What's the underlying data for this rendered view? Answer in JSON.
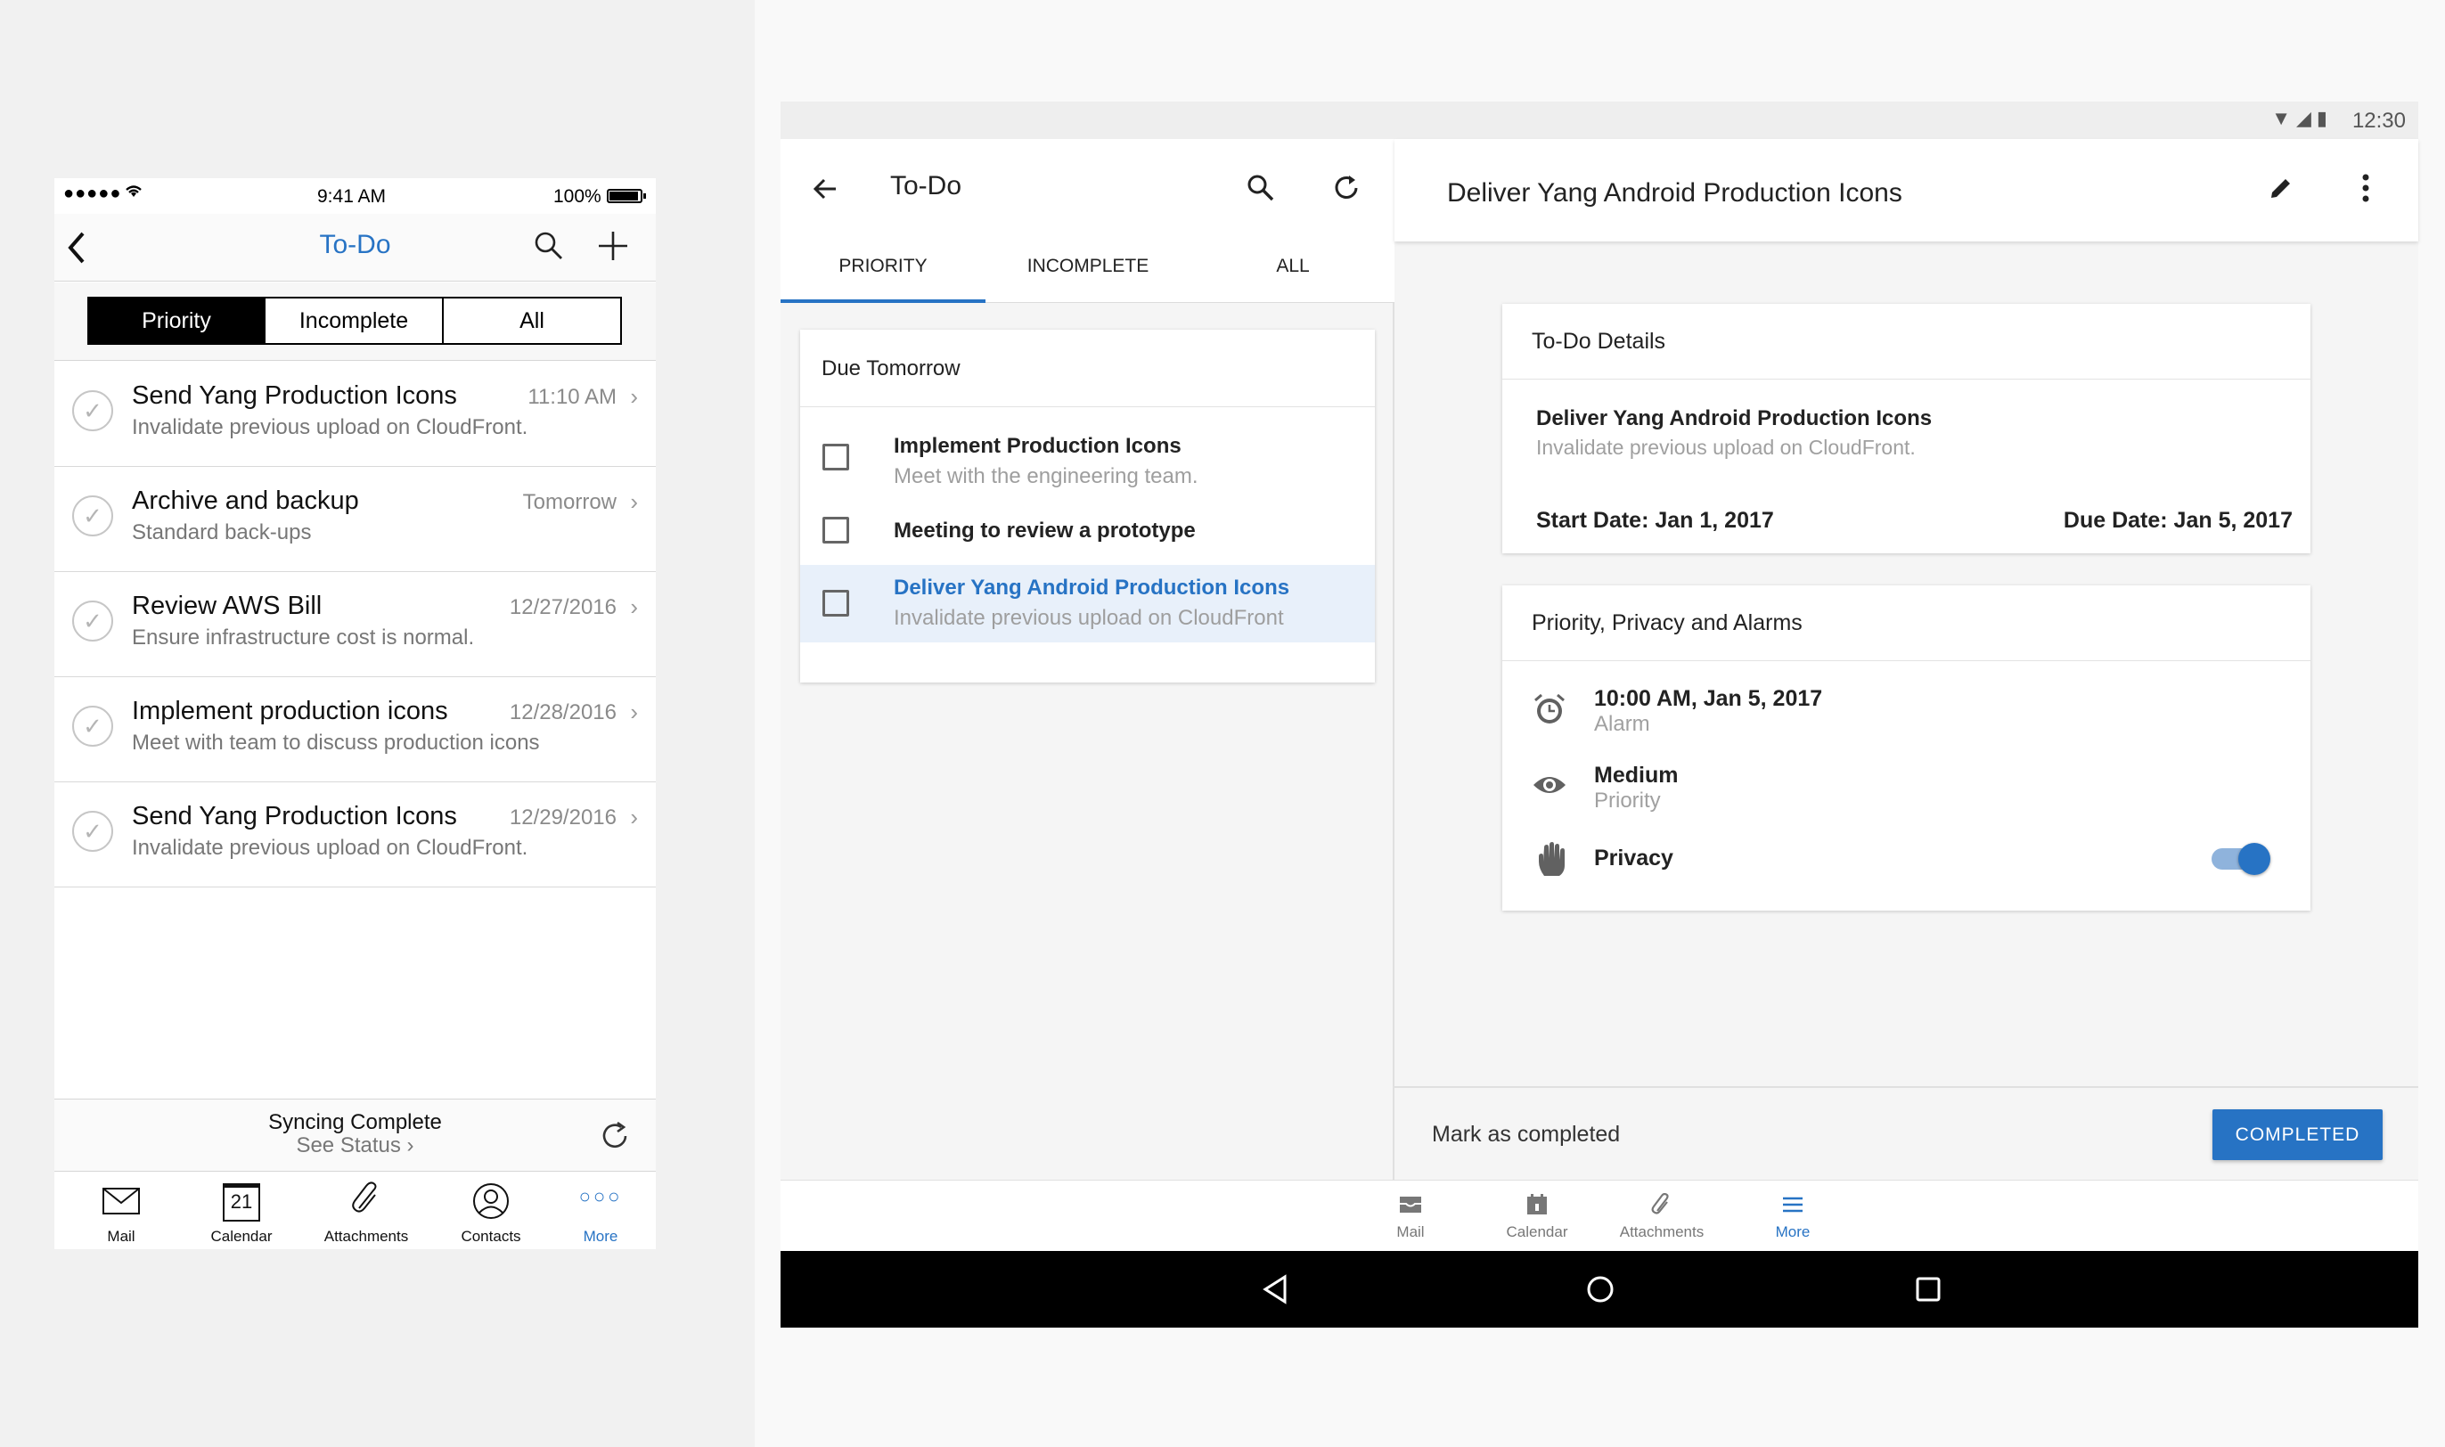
{
  "ios": {
    "status": {
      "time": "9:41 AM",
      "battery": "100%",
      "signal": "●●●●●"
    },
    "title": "To-Do",
    "segments": [
      "Priority",
      "Incomplete",
      "All"
    ],
    "items": [
      {
        "title": "Send Yang Production Icons",
        "subtitle": "Invalidate previous upload on CloudFront.",
        "date": "11:10 AM"
      },
      {
        "title": "Archive and backup",
        "subtitle": "Standard back-ups",
        "date": "Tomorrow"
      },
      {
        "title": "Review AWS Bill",
        "subtitle": "Ensure infrastructure cost is normal.",
        "date": "12/27/2016"
      },
      {
        "title": "Implement production icons",
        "subtitle": "Meet with team to discuss production icons",
        "date": "12/28/2016"
      },
      {
        "title": "Send Yang Production Icons",
        "subtitle": "Invalidate previous upload on CloudFront.",
        "date": "12/29/2016"
      }
    ],
    "sync": {
      "status": "Syncing Complete",
      "link": "See Status"
    },
    "tabs": [
      {
        "label": "Mail",
        "icon": "mail-icon"
      },
      {
        "label": "Calendar",
        "icon": "calendar-icon",
        "glyph": "21"
      },
      {
        "label": "Attachments",
        "icon": "paperclip-icon"
      },
      {
        "label": "Contacts",
        "icon": "contacts-icon"
      },
      {
        "label": "More",
        "icon": "more-icon"
      }
    ],
    "accent": "#2773c4"
  },
  "android": {
    "status": {
      "time": "12:30"
    },
    "list": {
      "title": "To-Do",
      "tabs": [
        "PRIORITY",
        "INCOMPLETE",
        "ALL"
      ],
      "section": "Due Tomorrow",
      "items": [
        {
          "title": "Implement Production Icons",
          "subtitle": "Meet with the engineering team."
        },
        {
          "title": "Meeting to review a prototype",
          "subtitle": ""
        },
        {
          "title": "Deliver Yang Android Production Icons",
          "subtitle": "Invalidate previous upload on CloudFront"
        }
      ]
    },
    "detail": {
      "title": "Deliver Yang Android Production Icons",
      "details_header": "To-Do Details",
      "task_title": "Deliver Yang Android Production Icons",
      "task_subtitle": "Invalidate previous upload on CloudFront.",
      "start_date": "Start Date: Jan 1, 2017",
      "due_date": "Due Date: Jan 5, 2017",
      "ppa_header": "Priority, Privacy and Alarms",
      "alarm_value": "10:00 AM, Jan 5, 2017",
      "alarm_label": "Alarm",
      "priority_value": "Medium",
      "priority_label": "Priority",
      "privacy_label": "Privacy",
      "privacy_on": true,
      "mark_label": "Mark as completed",
      "completed_button": "COMPLETED"
    },
    "tabs": [
      {
        "label": "Mail",
        "icon": "mail-icon"
      },
      {
        "label": "Calendar",
        "icon": "calendar-icon"
      },
      {
        "label": "Attachments",
        "icon": "paperclip-icon"
      },
      {
        "label": "More",
        "icon": "menu-icon"
      }
    ],
    "accent": "#2773c4"
  }
}
